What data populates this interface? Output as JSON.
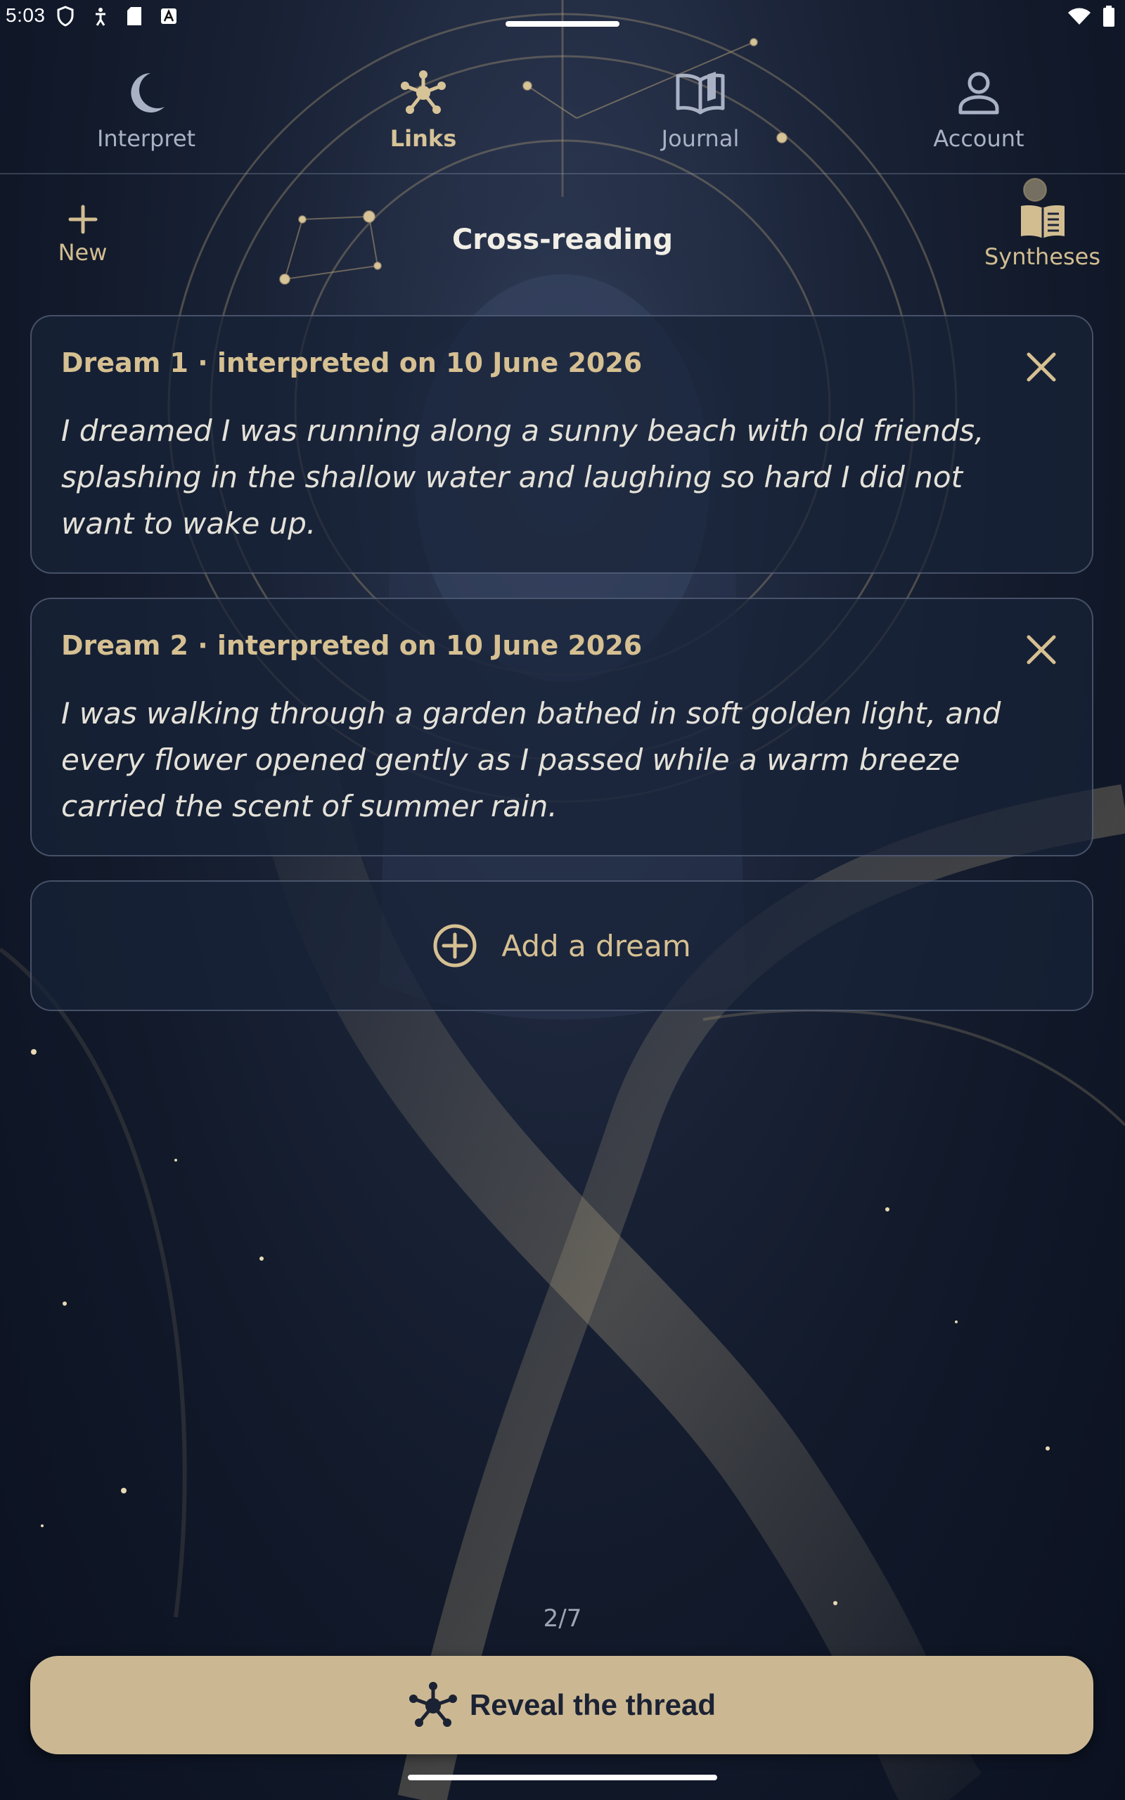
{
  "status_bar": {
    "time": "5:03",
    "left_icons": [
      "shield-icon",
      "accessibility-icon",
      "sd-card-icon",
      "font-a-icon"
    ],
    "right_icons": [
      "wifi-icon",
      "battery-icon"
    ]
  },
  "nav": {
    "tabs": [
      {
        "label": "Interpret",
        "icon": "moon-icon",
        "active": false
      },
      {
        "label": "Links",
        "icon": "constellation-icon",
        "active": true
      },
      {
        "label": "Journal",
        "icon": "book-open-icon",
        "active": false
      },
      {
        "label": "Account",
        "icon": "person-icon",
        "active": false
      }
    ]
  },
  "header": {
    "new_label": "New",
    "title": "Cross-reading",
    "syntheses_label": "Syntheses"
  },
  "dreams": [
    {
      "title": "Dream 1 · interpreted on 10 June 2026",
      "text": "I dreamed I was running along a sunny beach with old friends, splashing in the shallow water and laughing so hard I did not want to wake up."
    },
    {
      "title": "Dream 2 · interpreted on 10 June 2026",
      "text": "I was walking through a garden bathed in soft golden light, and every flower opened gently as I passed while a warm breeze carried the scent of summer rain."
    }
  ],
  "add_dream": {
    "label": "Add a dream"
  },
  "counter": "2/7",
  "reveal": {
    "label": "Reveal the thread"
  },
  "colors": {
    "accent_gold": "#cbb893",
    "card_bg": "#182238",
    "text_light": "#e4e1d8",
    "background": "#121a2b"
  }
}
